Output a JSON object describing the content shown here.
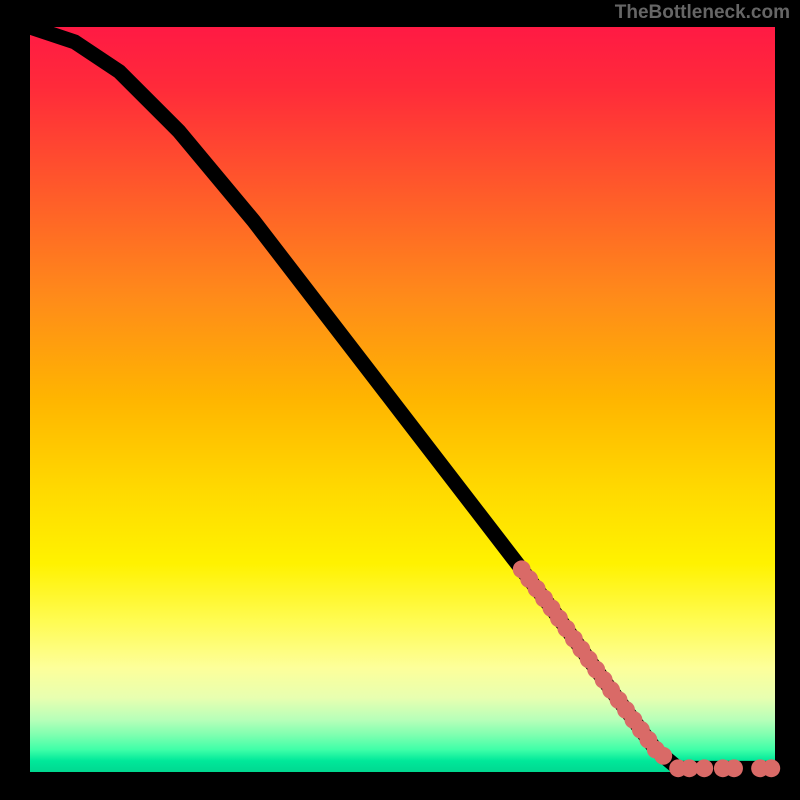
{
  "attribution": "TheBottleneck.com",
  "chart_data": {
    "type": "line",
    "title": "",
    "xlabel": "",
    "ylabel": "",
    "xlim": [
      0,
      100
    ],
    "ylim": [
      0,
      100
    ],
    "curve": [
      {
        "x": 0,
        "y": 100
      },
      {
        "x": 6,
        "y": 98
      },
      {
        "x": 12,
        "y": 94
      },
      {
        "x": 20,
        "y": 86
      },
      {
        "x": 30,
        "y": 74
      },
      {
        "x": 40,
        "y": 61
      },
      {
        "x": 50,
        "y": 48
      },
      {
        "x": 60,
        "y": 35
      },
      {
        "x": 70,
        "y": 22
      },
      {
        "x": 78,
        "y": 11
      },
      {
        "x": 84,
        "y": 3
      },
      {
        "x": 87,
        "y": 0.5
      },
      {
        "x": 100,
        "y": 0.5
      }
    ],
    "dot_ranges": [
      {
        "x0": 66,
        "x1": 71,
        "n": 6
      },
      {
        "x0": 72,
        "x1": 76,
        "n": 5
      },
      {
        "x0": 77,
        "x1": 81,
        "n": 5
      },
      {
        "x0": 82,
        "x1": 85,
        "n": 4
      }
    ],
    "flat_dots_x": [
      87,
      88.5,
      90.5,
      93,
      94.5,
      98,
      99.5
    ],
    "dot_radius": 1.2,
    "colors": {
      "curve": "#000000",
      "dots": "#d96a67",
      "gradient_top": "#ff1a44",
      "gradient_bottom": "#00d890"
    }
  }
}
